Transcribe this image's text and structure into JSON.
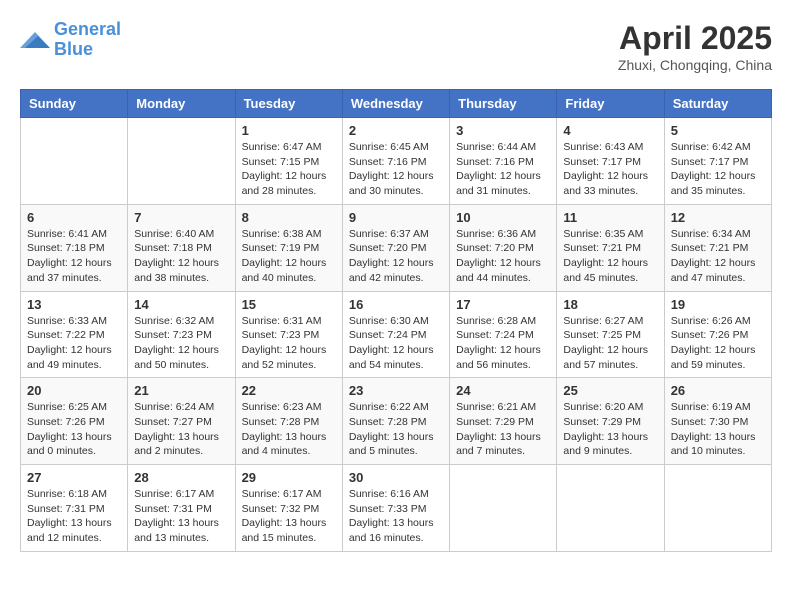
{
  "header": {
    "logo_line1": "General",
    "logo_line2": "Blue",
    "main_title": "April 2025",
    "subtitle": "Zhuxi, Chongqing, China"
  },
  "calendar": {
    "days_of_week": [
      "Sunday",
      "Monday",
      "Tuesday",
      "Wednesday",
      "Thursday",
      "Friday",
      "Saturday"
    ],
    "weeks": [
      [
        {
          "day": "",
          "info": ""
        },
        {
          "day": "",
          "info": ""
        },
        {
          "day": "1",
          "info": "Sunrise: 6:47 AM\nSunset: 7:15 PM\nDaylight: 12 hours and 28 minutes."
        },
        {
          "day": "2",
          "info": "Sunrise: 6:45 AM\nSunset: 7:16 PM\nDaylight: 12 hours and 30 minutes."
        },
        {
          "day": "3",
          "info": "Sunrise: 6:44 AM\nSunset: 7:16 PM\nDaylight: 12 hours and 31 minutes."
        },
        {
          "day": "4",
          "info": "Sunrise: 6:43 AM\nSunset: 7:17 PM\nDaylight: 12 hours and 33 minutes."
        },
        {
          "day": "5",
          "info": "Sunrise: 6:42 AM\nSunset: 7:17 PM\nDaylight: 12 hours and 35 minutes."
        }
      ],
      [
        {
          "day": "6",
          "info": "Sunrise: 6:41 AM\nSunset: 7:18 PM\nDaylight: 12 hours and 37 minutes."
        },
        {
          "day": "7",
          "info": "Sunrise: 6:40 AM\nSunset: 7:18 PM\nDaylight: 12 hours and 38 minutes."
        },
        {
          "day": "8",
          "info": "Sunrise: 6:38 AM\nSunset: 7:19 PM\nDaylight: 12 hours and 40 minutes."
        },
        {
          "day": "9",
          "info": "Sunrise: 6:37 AM\nSunset: 7:20 PM\nDaylight: 12 hours and 42 minutes."
        },
        {
          "day": "10",
          "info": "Sunrise: 6:36 AM\nSunset: 7:20 PM\nDaylight: 12 hours and 44 minutes."
        },
        {
          "day": "11",
          "info": "Sunrise: 6:35 AM\nSunset: 7:21 PM\nDaylight: 12 hours and 45 minutes."
        },
        {
          "day": "12",
          "info": "Sunrise: 6:34 AM\nSunset: 7:21 PM\nDaylight: 12 hours and 47 minutes."
        }
      ],
      [
        {
          "day": "13",
          "info": "Sunrise: 6:33 AM\nSunset: 7:22 PM\nDaylight: 12 hours and 49 minutes."
        },
        {
          "day": "14",
          "info": "Sunrise: 6:32 AM\nSunset: 7:23 PM\nDaylight: 12 hours and 50 minutes."
        },
        {
          "day": "15",
          "info": "Sunrise: 6:31 AM\nSunset: 7:23 PM\nDaylight: 12 hours and 52 minutes."
        },
        {
          "day": "16",
          "info": "Sunrise: 6:30 AM\nSunset: 7:24 PM\nDaylight: 12 hours and 54 minutes."
        },
        {
          "day": "17",
          "info": "Sunrise: 6:28 AM\nSunset: 7:24 PM\nDaylight: 12 hours and 56 minutes."
        },
        {
          "day": "18",
          "info": "Sunrise: 6:27 AM\nSunset: 7:25 PM\nDaylight: 12 hours and 57 minutes."
        },
        {
          "day": "19",
          "info": "Sunrise: 6:26 AM\nSunset: 7:26 PM\nDaylight: 12 hours and 59 minutes."
        }
      ],
      [
        {
          "day": "20",
          "info": "Sunrise: 6:25 AM\nSunset: 7:26 PM\nDaylight: 13 hours and 0 minutes."
        },
        {
          "day": "21",
          "info": "Sunrise: 6:24 AM\nSunset: 7:27 PM\nDaylight: 13 hours and 2 minutes."
        },
        {
          "day": "22",
          "info": "Sunrise: 6:23 AM\nSunset: 7:28 PM\nDaylight: 13 hours and 4 minutes."
        },
        {
          "day": "23",
          "info": "Sunrise: 6:22 AM\nSunset: 7:28 PM\nDaylight: 13 hours and 5 minutes."
        },
        {
          "day": "24",
          "info": "Sunrise: 6:21 AM\nSunset: 7:29 PM\nDaylight: 13 hours and 7 minutes."
        },
        {
          "day": "25",
          "info": "Sunrise: 6:20 AM\nSunset: 7:29 PM\nDaylight: 13 hours and 9 minutes."
        },
        {
          "day": "26",
          "info": "Sunrise: 6:19 AM\nSunset: 7:30 PM\nDaylight: 13 hours and 10 minutes."
        }
      ],
      [
        {
          "day": "27",
          "info": "Sunrise: 6:18 AM\nSunset: 7:31 PM\nDaylight: 13 hours and 12 minutes."
        },
        {
          "day": "28",
          "info": "Sunrise: 6:17 AM\nSunset: 7:31 PM\nDaylight: 13 hours and 13 minutes."
        },
        {
          "day": "29",
          "info": "Sunrise: 6:17 AM\nSunset: 7:32 PM\nDaylight: 13 hours and 15 minutes."
        },
        {
          "day": "30",
          "info": "Sunrise: 6:16 AM\nSunset: 7:33 PM\nDaylight: 13 hours and 16 minutes."
        },
        {
          "day": "",
          "info": ""
        },
        {
          "day": "",
          "info": ""
        },
        {
          "day": "",
          "info": ""
        }
      ]
    ]
  }
}
